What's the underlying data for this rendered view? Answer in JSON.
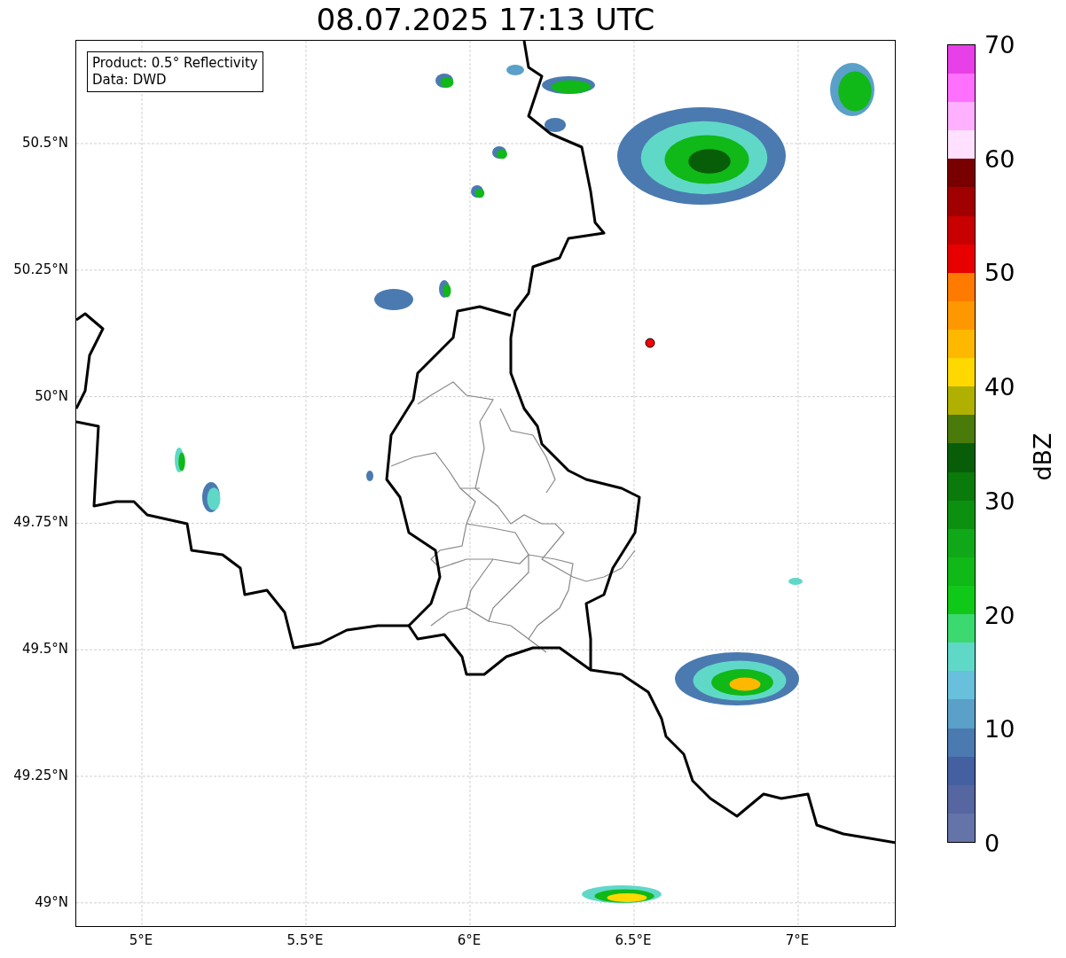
{
  "title": "08.07.2025 17:13 UTC",
  "legend": [
    "Product: 0.5° Reflectivity",
    "Data: DWD"
  ],
  "latitude_labels": [
    "50.5°N",
    "50.25°N",
    "50°N",
    "49.75°N",
    "49.5°N",
    "49.25°N",
    "49°N"
  ],
  "longitude_labels": [
    "5°E",
    "5.5°E",
    "6°E",
    "6.5°E",
    "7°E"
  ],
  "colorbar": {
    "label": "dBZ",
    "ticks": [
      "70",
      "60",
      "50",
      "40",
      "30",
      "20",
      "10",
      "0"
    ]
  }
}
